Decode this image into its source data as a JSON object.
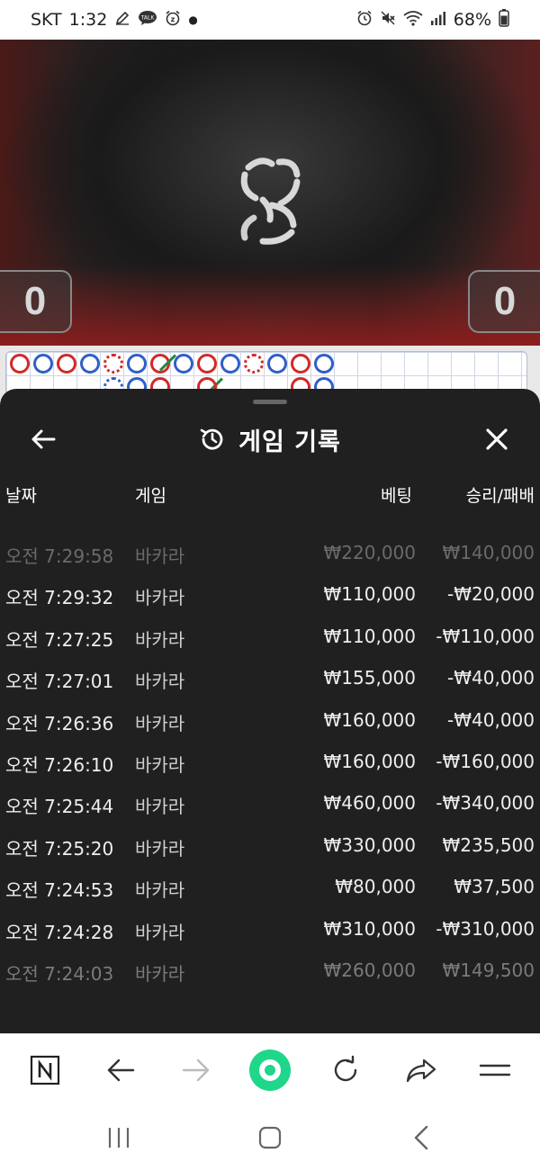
{
  "status_bar": {
    "carrier": "SKT",
    "time": "1:32",
    "battery": "68%",
    "left_icons": [
      "pen-icon",
      "talk-icon",
      "alarm-z-icon",
      "dot-icon"
    ],
    "right_icons": [
      "alarm-icon",
      "mute-icon",
      "wifi-icon",
      "signal-icon",
      "battery-icon"
    ]
  },
  "video": {
    "score_left": "0",
    "score_right": "0",
    "loading_icon": "loading-spinner-icon"
  },
  "sheet": {
    "title": "게임 기록",
    "title_icon": "history-icon",
    "back_icon": "arrow-left-icon",
    "close_icon": "close-icon",
    "columns": {
      "date": "날짜",
      "game": "게임",
      "bet": "베팅",
      "result": "승리/패배"
    },
    "rows": [
      {
        "date": "오전 7:29:58",
        "game": "바카라",
        "bet": "₩220,000",
        "result": "₩140,000"
      },
      {
        "date": "오전 7:29:32",
        "game": "바카라",
        "bet": "₩110,000",
        "result": "-₩20,000"
      },
      {
        "date": "오전 7:27:25",
        "game": "바카라",
        "bet": "₩110,000",
        "result": "-₩110,000"
      },
      {
        "date": "오전 7:27:01",
        "game": "바카라",
        "bet": "₩155,000",
        "result": "-₩40,000"
      },
      {
        "date": "오전 7:26:36",
        "game": "바카라",
        "bet": "₩160,000",
        "result": "-₩40,000"
      },
      {
        "date": "오전 7:26:10",
        "game": "바카라",
        "bet": "₩160,000",
        "result": "-₩160,000"
      },
      {
        "date": "오전 7:25:44",
        "game": "바카라",
        "bet": "₩460,000",
        "result": "-₩340,000"
      },
      {
        "date": "오전 7:25:20",
        "game": "바카라",
        "bet": "₩330,000",
        "result": "₩235,500"
      },
      {
        "date": "오전 7:24:53",
        "game": "바카라",
        "bet": "₩80,000",
        "result": "₩37,500"
      },
      {
        "date": "오전 7:24:28",
        "game": "바카라",
        "bet": "₩310,000",
        "result": "-₩310,000"
      },
      {
        "date": "오전 7:24:03",
        "game": "바카라",
        "bet": "₩260,000",
        "result": "₩149,500"
      }
    ]
  },
  "toolbar": {
    "items": [
      "naver-n-icon",
      "back-arrow-icon",
      "forward-arrow-icon",
      "green-home-icon",
      "refresh-icon",
      "share-icon",
      "menu-icon"
    ]
  },
  "navbar": {
    "items": [
      "recent-apps-icon",
      "home-icon",
      "back-icon"
    ]
  },
  "colors": {
    "sheet_bg": "#202020",
    "accent_green": "#1fd68a",
    "road_blue": "#2f5fc8",
    "road_red": "#d02a2a"
  }
}
